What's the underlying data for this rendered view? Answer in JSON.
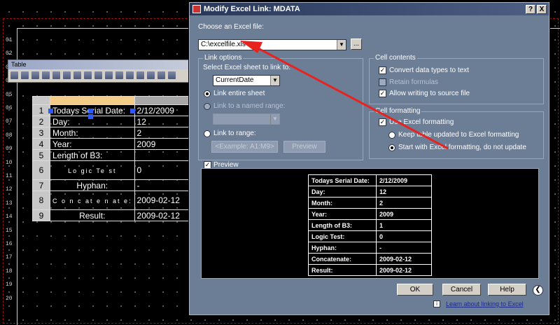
{
  "colors": {
    "accent_red": "#e8231f",
    "dialog_bg": "#6c7d96",
    "title_bar": "#2a3b5e",
    "selection_blue": "#2a5bff"
  },
  "cad": {
    "row_numbers": [
      "01",
      "02",
      "03",
      "04",
      "05",
      "06",
      "07",
      "08",
      "09",
      "10",
      "11",
      "12",
      "13",
      "14",
      "15",
      "16",
      "17",
      "18",
      "19",
      "20"
    ]
  },
  "toolbar": {
    "title": "Table"
  },
  "cad_table": {
    "rows": [
      {
        "n": "1",
        "a": "Todays Serial Date:",
        "b": "2/12/2009"
      },
      {
        "n": "2",
        "a": "Day:",
        "b": "12"
      },
      {
        "n": "3",
        "a": "Month:",
        "b": "2"
      },
      {
        "n": "4",
        "a": "Year:",
        "b": "2009"
      },
      {
        "n": "5",
        "a": "Length of B3:",
        "b": ""
      },
      {
        "n": "6",
        "a": "Lo gic Te st",
        "b": "0"
      },
      {
        "n": "7",
        "a": "Hyphan:",
        "b": "-"
      },
      {
        "n": "8",
        "a": "C o n c at e n at e:",
        "b": "2009-02-12"
      },
      {
        "n": "9",
        "a": "Result:",
        "b": "2009-02-12"
      }
    ]
  },
  "dialog": {
    "title": "Modify Excel Link: MDATA",
    "help_btn": "?",
    "close_btn": "X",
    "choose_label": "Choose an Excel file:",
    "file_value": "C:\\excelfile.xls",
    "browse_label": "...",
    "link_options": {
      "title": "Link options",
      "sheet_label": "Select Excel sheet to link to:",
      "sheet_value": "CurrentDate",
      "entire_sheet": "Link entire sheet",
      "named_range": "Link to a named range:",
      "link_range": "Link to range:",
      "range_placeholder": "<Example: A1:M9>",
      "preview_btn": "Preview"
    },
    "cell_contents": {
      "title": "Cell contents",
      "convert": "Convert data types to text",
      "retain": "Retain formulas",
      "allow": "Allow writing to source file"
    },
    "cell_formatting": {
      "title": "Cell formatting",
      "use_excel": "Use Excel formatting",
      "keep_updated": "Keep table updated to Excel formatting",
      "start_with": "Start with Excel formatting, do not update"
    },
    "preview": {
      "title": "Preview",
      "rows": [
        {
          "a": "Todays Serial Date:",
          "b": "2/12/2009"
        },
        {
          "a": "Day:",
          "b": "12"
        },
        {
          "a": "Month:",
          "b": "2"
        },
        {
          "a": "Year:",
          "b": "2009"
        },
        {
          "a": "Length of B3:",
          "b": "1"
        },
        {
          "a": "Logic Test:",
          "b": "0"
        },
        {
          "a": "Hyphan:",
          "b": "-"
        },
        {
          "a": "Concatenate:",
          "b": "2009-02-12"
        },
        {
          "a": "Result:",
          "b": "2009-02-12"
        }
      ]
    },
    "ok_label": "OK",
    "cancel_label": "Cancel",
    "help_label": "Help",
    "learn_link": "Learn about linking to Excel",
    "info_icon": "i"
  }
}
